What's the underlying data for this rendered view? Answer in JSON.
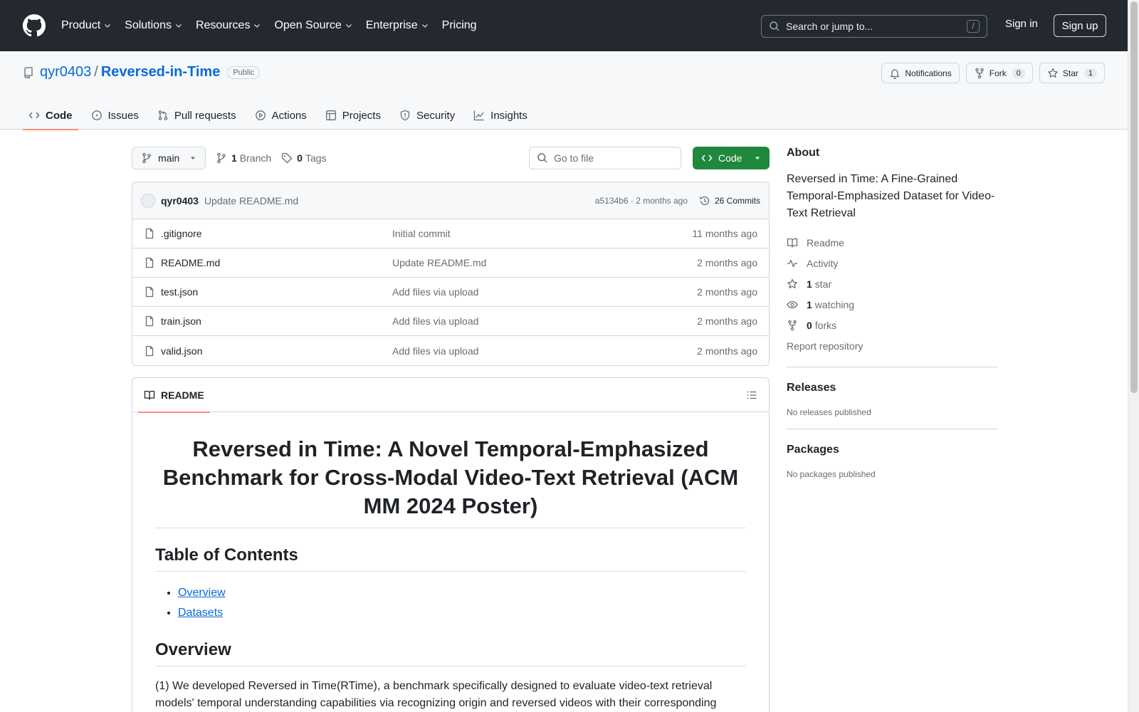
{
  "header": {
    "nav": [
      {
        "label": "Product"
      },
      {
        "label": "Solutions"
      },
      {
        "label": "Resources"
      },
      {
        "label": "Open Source"
      },
      {
        "label": "Enterprise"
      },
      {
        "label": "Pricing"
      }
    ],
    "search_placeholder": "Search or jump to...",
    "search_key": "/",
    "sign_in": "Sign in",
    "sign_up": "Sign up"
  },
  "repo": {
    "owner": "qyr0403",
    "separator": "/",
    "name": "Reversed-in-Time",
    "visibility": "Public",
    "notifications_label": "Notifications",
    "fork_label": "Fork",
    "fork_count": "0",
    "star_label": "Star",
    "star_count": "1",
    "tabs": [
      {
        "label": "Code"
      },
      {
        "label": "Issues"
      },
      {
        "label": "Pull requests"
      },
      {
        "label": "Actions"
      },
      {
        "label": "Projects"
      },
      {
        "label": "Security"
      },
      {
        "label": "Insights"
      }
    ]
  },
  "toolbar": {
    "branch": "main",
    "branch_count": "1",
    "branch_label": "Branch",
    "tag_count": "0",
    "tag_label": "Tags",
    "goto_placeholder": "Go to file",
    "code_label": "Code"
  },
  "commit": {
    "author": "qyr0403",
    "message": "Update README.md",
    "hash_time": "a5134b6 · 2 months ago",
    "commits_label": "26 Commits"
  },
  "files": [
    {
      "name": ".gitignore",
      "message": "Initial commit",
      "date": "11 months ago"
    },
    {
      "name": "README.md",
      "message": "Update README.md",
      "date": "2 months ago"
    },
    {
      "name": "test.json",
      "message": "Add files via upload",
      "date": "2 months ago"
    },
    {
      "name": "train.json",
      "message": "Add files via upload",
      "date": "2 months ago"
    },
    {
      "name": "valid.json",
      "message": "Add files via upload",
      "date": "2 months ago"
    }
  ],
  "readme": {
    "tab_label": "README",
    "title": "Reversed in Time: A Novel Temporal-Emphasized Benchmark for Cross-Modal Video-Text Retrieval (ACM MM 2024 Poster)",
    "toc_heading": "Table of Contents",
    "toc": [
      "Overview",
      "Datasets"
    ],
    "overview_heading": "Overview",
    "overview_text": "(1) We developed Reversed in Time(RTime), a benchmark specifically designed to evaluate video-text retrieval models' temporal understanding capabilities via recognizing origin and reversed videos with their corresponding"
  },
  "sidebar": {
    "about_heading": "About",
    "description": "Reversed in Time: A Fine-Grained Temporal-Emphasized Dataset for Video-Text Retrieval",
    "readme": "Readme",
    "activity": "Activity",
    "stars_count": "1",
    "stars_label": "star",
    "watching_count": "1",
    "watching_label": "watching",
    "forks_count": "0",
    "forks_label": "forks",
    "report": "Report repository",
    "releases_heading": "Releases",
    "releases_text": "No releases published",
    "packages_heading": "Packages",
    "packages_text": "No packages published"
  },
  "colors": {
    "header_bg": "#24292f",
    "link": "#0969da",
    "code_button": "#1f883d",
    "tab_underline": "#fd8c73"
  }
}
